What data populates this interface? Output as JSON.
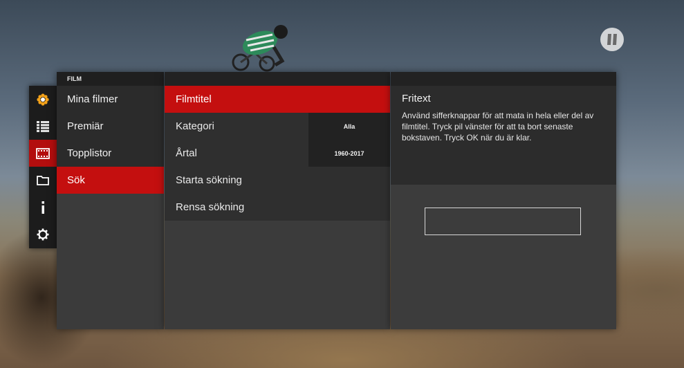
{
  "sidebar_icons": [
    {
      "name": "flower-icon",
      "active": false
    },
    {
      "name": "grid-icon",
      "active": false
    },
    {
      "name": "film-icon",
      "active": true
    },
    {
      "name": "folder-icon",
      "active": false
    },
    {
      "name": "info-icon",
      "active": false
    },
    {
      "name": "gear-icon",
      "active": false
    }
  ],
  "film_menu": {
    "header": "FILM",
    "items": [
      {
        "label": "Mina filmer"
      },
      {
        "label": "Premiär"
      },
      {
        "label": "Topplistor"
      },
      {
        "label": "Sök"
      }
    ],
    "active_index": 3
  },
  "search": {
    "rows": [
      {
        "label": "Filmtitel",
        "value": ""
      },
      {
        "label": "Kategori",
        "value": "Alla"
      },
      {
        "label": "Årtal",
        "value": "1960-2017"
      },
      {
        "label": "Starta sökning",
        "value": ""
      },
      {
        "label": "Rensa sökning",
        "value": ""
      }
    ],
    "active_index": 0
  },
  "detail": {
    "title": "Fritext",
    "description": "Använd sifferknappar för att mata in hela eller del av filmtitel. Tryck pil vänster för att ta bort senaste bokstaven. Tryck OK när du är klar.",
    "input_value": ""
  },
  "colors": {
    "accent": "#c40f0f",
    "panel": "#3b3b3b",
    "rail": "#1c1c1c"
  }
}
